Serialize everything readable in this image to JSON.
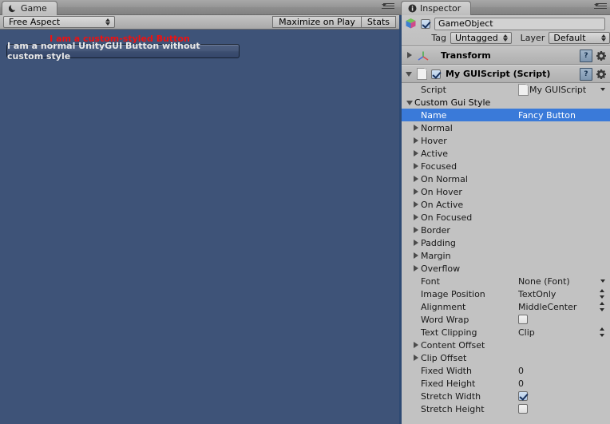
{
  "game_panel": {
    "tab": {
      "label": "Game",
      "icon": "game-moon-icon"
    },
    "toolbar": {
      "aspect": {
        "value": "Free Aspect"
      },
      "maximize_on_play": "Maximize on Play",
      "stats": "Stats"
    },
    "view": {
      "background_color": "#3e5378",
      "custom_styled_button_label": "I am a custom-styled Button",
      "custom_styled_button_color": "#ee1111",
      "normal_button_label": "I am a normal UnityGUI Button without custom style"
    }
  },
  "inspector": {
    "tab": {
      "label": "Inspector",
      "icon": "info-icon"
    },
    "gameobject": {
      "enabled": true,
      "name": "GameObject",
      "tag_label": "Tag",
      "tag_value": "Untagged",
      "layer_label": "Layer",
      "layer_value": "Default"
    },
    "components": [
      {
        "name": "transform-component",
        "title": "Transform",
        "expanded": false,
        "has_enable_checkbox": false,
        "icon": "transform-axis-icon"
      },
      {
        "name": "guiscript-component",
        "title": "My GUIScript (Script)",
        "expanded": true,
        "has_enable_checkbox": true,
        "enabled": true,
        "icon": "script-file-icon"
      }
    ],
    "script_row": {
      "label": "Script",
      "value": "My GUIScript"
    },
    "custom_gui_style_group": "Custom Gui Style",
    "properties": [
      {
        "label": "Name",
        "value": "Fancy Button",
        "kind": "text",
        "selected": true,
        "indent": 1
      },
      {
        "label": "Normal",
        "value": "",
        "kind": "foldout",
        "selected": false,
        "indent": 1
      },
      {
        "label": "Hover",
        "value": "",
        "kind": "foldout",
        "selected": false,
        "indent": 1
      },
      {
        "label": "Active",
        "value": "",
        "kind": "foldout",
        "selected": false,
        "indent": 1
      },
      {
        "label": "Focused",
        "value": "",
        "kind": "foldout",
        "selected": false,
        "indent": 1
      },
      {
        "label": "On Normal",
        "value": "",
        "kind": "foldout",
        "selected": false,
        "indent": 1
      },
      {
        "label": "On Hover",
        "value": "",
        "kind": "foldout",
        "selected": false,
        "indent": 1
      },
      {
        "label": "On Active",
        "value": "",
        "kind": "foldout",
        "selected": false,
        "indent": 1
      },
      {
        "label": "On Focused",
        "value": "",
        "kind": "foldout",
        "selected": false,
        "indent": 1
      },
      {
        "label": "Border",
        "value": "",
        "kind": "foldout",
        "selected": false,
        "indent": 1
      },
      {
        "label": "Padding",
        "value": "",
        "kind": "foldout",
        "selected": false,
        "indent": 1
      },
      {
        "label": "Margin",
        "value": "",
        "kind": "foldout",
        "selected": false,
        "indent": 1
      },
      {
        "label": "Overflow",
        "value": "",
        "kind": "foldout",
        "selected": false,
        "indent": 1
      },
      {
        "label": "Font",
        "value": "None (Font)",
        "kind": "object",
        "selected": false,
        "indent": 1
      },
      {
        "label": "Image Position",
        "value": "TextOnly",
        "kind": "enum",
        "selected": false,
        "indent": 1
      },
      {
        "label": "Alignment",
        "value": "MiddleCenter",
        "kind": "enum",
        "selected": false,
        "indent": 1
      },
      {
        "label": "Word Wrap",
        "value": false,
        "kind": "checkbox",
        "selected": false,
        "indent": 1
      },
      {
        "label": "Text Clipping",
        "value": "Clip",
        "kind": "enum",
        "selected": false,
        "indent": 1
      },
      {
        "label": "Content Offset",
        "value": "",
        "kind": "foldout",
        "selected": false,
        "indent": 1
      },
      {
        "label": "Clip Offset",
        "value": "",
        "kind": "foldout",
        "selected": false,
        "indent": 1
      },
      {
        "label": "Fixed Width",
        "value": "0",
        "kind": "number",
        "selected": false,
        "indent": 1
      },
      {
        "label": "Fixed Height",
        "value": "0",
        "kind": "number",
        "selected": false,
        "indent": 1
      },
      {
        "label": "Stretch Width",
        "value": true,
        "kind": "checkbox",
        "selected": false,
        "indent": 1
      },
      {
        "label": "Stretch Height",
        "value": false,
        "kind": "checkbox",
        "selected": false,
        "indent": 1
      }
    ],
    "help_icon_label": "?",
    "colors": {
      "selection_blue": "#3a7ad9",
      "panel_grey": "#c2c2c2",
      "accent_edge": "#2e4a73"
    }
  }
}
